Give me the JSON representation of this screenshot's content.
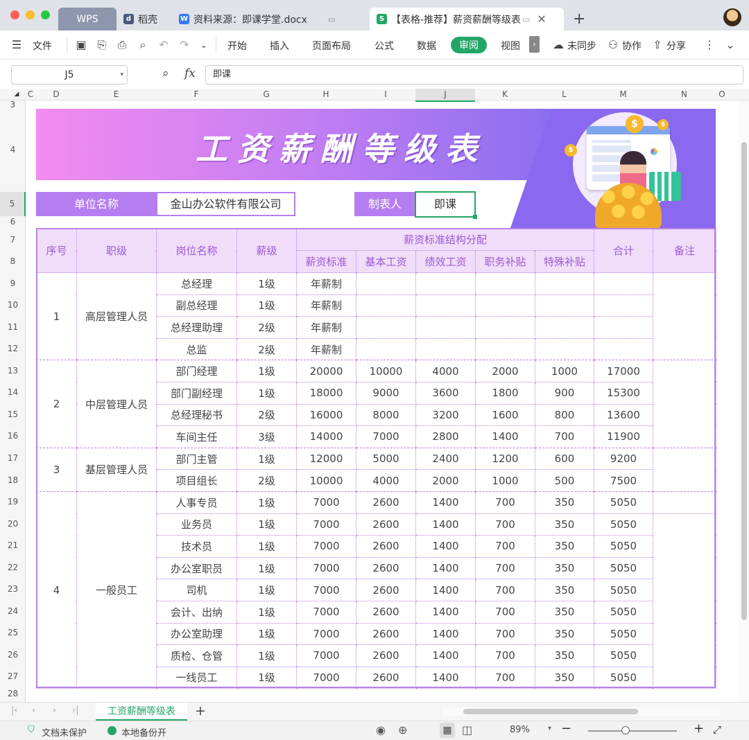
{
  "titlebar": {
    "tabs": [
      {
        "label": "WPS"
      },
      {
        "label": "稻壳"
      },
      {
        "label": "资料来源：即课学堂.docx"
      },
      {
        "label": "【表格-推荐】薪资薪酬等级表"
      }
    ]
  },
  "toolbar": {
    "file_label": "文件",
    "menus": [
      "开始",
      "插入",
      "页面布局",
      "公式",
      "数据",
      "审阅",
      "视图"
    ],
    "active_menu": "审阅",
    "sync_label": "未同步",
    "collab_label": "协作",
    "share_label": "分享"
  },
  "formula_bar": {
    "cell_ref": "J5",
    "fx_label": "fx",
    "value": "即课"
  },
  "columns": [
    "C",
    "D",
    "E",
    "F",
    "G",
    "H",
    "I",
    "J",
    "K",
    "L",
    "M",
    "N",
    "O"
  ],
  "rows": [
    "3",
    "4",
    "5",
    "6",
    "7",
    "8",
    "9",
    "10",
    "11",
    "12",
    "13",
    "14",
    "15",
    "16",
    "17",
    "18",
    "19",
    "20",
    "21",
    "22",
    "23",
    "24",
    "25",
    "26",
    "27",
    "28"
  ],
  "banner": {
    "title": "工资薪酬等级表"
  },
  "info": {
    "unit_label": "单位名称",
    "unit_value": "金山办公软件有限公司",
    "maker_label": "制表人",
    "maker_value": "即课"
  },
  "table": {
    "headers": {
      "no": "序号",
      "level": "职级",
      "position": "岗位名称",
      "grade": "薪级",
      "structure": "薪资标准结构分配",
      "total": "合计",
      "remark": "备注",
      "sub": [
        "薪资标准",
        "基本工资",
        "绩效工资",
        "职务补贴",
        "特殊补贴"
      ]
    },
    "groups": [
      {
        "no": "1",
        "level": "高层管理人员",
        "rows": [
          [
            "总经理",
            "1级",
            "年薪制",
            "",
            "",
            "",
            "",
            ""
          ],
          [
            "副总经理",
            "1级",
            "年薪制",
            "",
            "",
            "",
            "",
            ""
          ],
          [
            "总经理助理",
            "2级",
            "年薪制",
            "",
            "",
            "",
            "",
            ""
          ],
          [
            "总监",
            "2级",
            "年薪制",
            "",
            "",
            "",
            "",
            ""
          ]
        ]
      },
      {
        "no": "2",
        "level": "中层管理人员",
        "rows": [
          [
            "部门经理",
            "1级",
            "20000",
            "10000",
            "4000",
            "2000",
            "1000",
            "17000"
          ],
          [
            "部门副经理",
            "1级",
            "18000",
            "9000",
            "3600",
            "1800",
            "900",
            "15300"
          ],
          [
            "总经理秘书",
            "2级",
            "16000",
            "8000",
            "3200",
            "1600",
            "800",
            "13600"
          ],
          [
            "车间主任",
            "3级",
            "14000",
            "7000",
            "2800",
            "1400",
            "700",
            "11900"
          ]
        ]
      },
      {
        "no": "3",
        "level": "基层管理人员",
        "rows": [
          [
            "部门主管",
            "1级",
            "12000",
            "5000",
            "2400",
            "1200",
            "600",
            "9200"
          ],
          [
            "项目组长",
            "2级",
            "10000",
            "4000",
            "2000",
            "1000",
            "500",
            "7500"
          ]
        ]
      },
      {
        "no": "4",
        "level": "一般员工",
        "rows": [
          [
            "人事专员",
            "1级",
            "7000",
            "2600",
            "1400",
            "700",
            "350",
            "5050"
          ],
          [
            "业务员",
            "1级",
            "7000",
            "2600",
            "1400",
            "700",
            "350",
            "5050"
          ],
          [
            "技术员",
            "1级",
            "7000",
            "2600",
            "1400",
            "700",
            "350",
            "5050"
          ],
          [
            "办公室职员",
            "1级",
            "7000",
            "2600",
            "1400",
            "700",
            "350",
            "5050"
          ],
          [
            "司机",
            "1级",
            "7000",
            "2600",
            "1400",
            "700",
            "350",
            "5050"
          ],
          [
            "会计、出纳",
            "1级",
            "7000",
            "2600",
            "1400",
            "700",
            "350",
            "5050"
          ],
          [
            "办公室助理",
            "1级",
            "7000",
            "2600",
            "1400",
            "700",
            "350",
            "5050"
          ],
          [
            "质检、仓管",
            "1级",
            "7000",
            "2600",
            "1400",
            "700",
            "350",
            "5050"
          ],
          [
            "一线员工",
            "1级",
            "7000",
            "2600",
            "1400",
            "700",
            "350",
            "5050"
          ]
        ]
      }
    ]
  },
  "sheet_tab": "工资薪酬等级表",
  "status": {
    "protect": "文档未保护",
    "backup": "本地备份开",
    "zoom": "89%",
    "zoom_level": 0.42
  },
  "colors": {
    "accent": "#22a665",
    "purple": "#9a5ad2",
    "header_fill": "#f1ddfa"
  }
}
